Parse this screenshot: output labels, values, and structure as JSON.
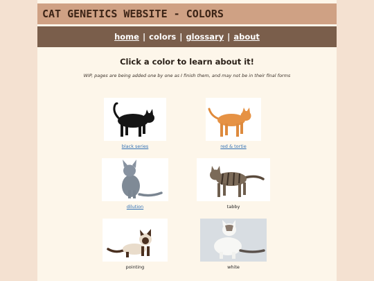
{
  "header": {
    "title": "CAT GENETICS WEBSITE - COLORS"
  },
  "nav": {
    "home": "home",
    "colors": "colors",
    "glossary": "glossary",
    "about": "about",
    "separator": "|"
  },
  "intro": {
    "heading": "Click a color to learn about it!",
    "note": "WIP, pages are being added one by one as I finish them, and may not be in their final forms"
  },
  "gallery": [
    {
      "label": "black series",
      "linked": true
    },
    {
      "label": "red & tortie",
      "linked": true
    },
    {
      "label": "dilution",
      "linked": true
    },
    {
      "label": "tabby",
      "linked": false
    },
    {
      "label": "pointing",
      "linked": false
    },
    {
      "label": "white",
      "linked": false
    }
  ]
}
